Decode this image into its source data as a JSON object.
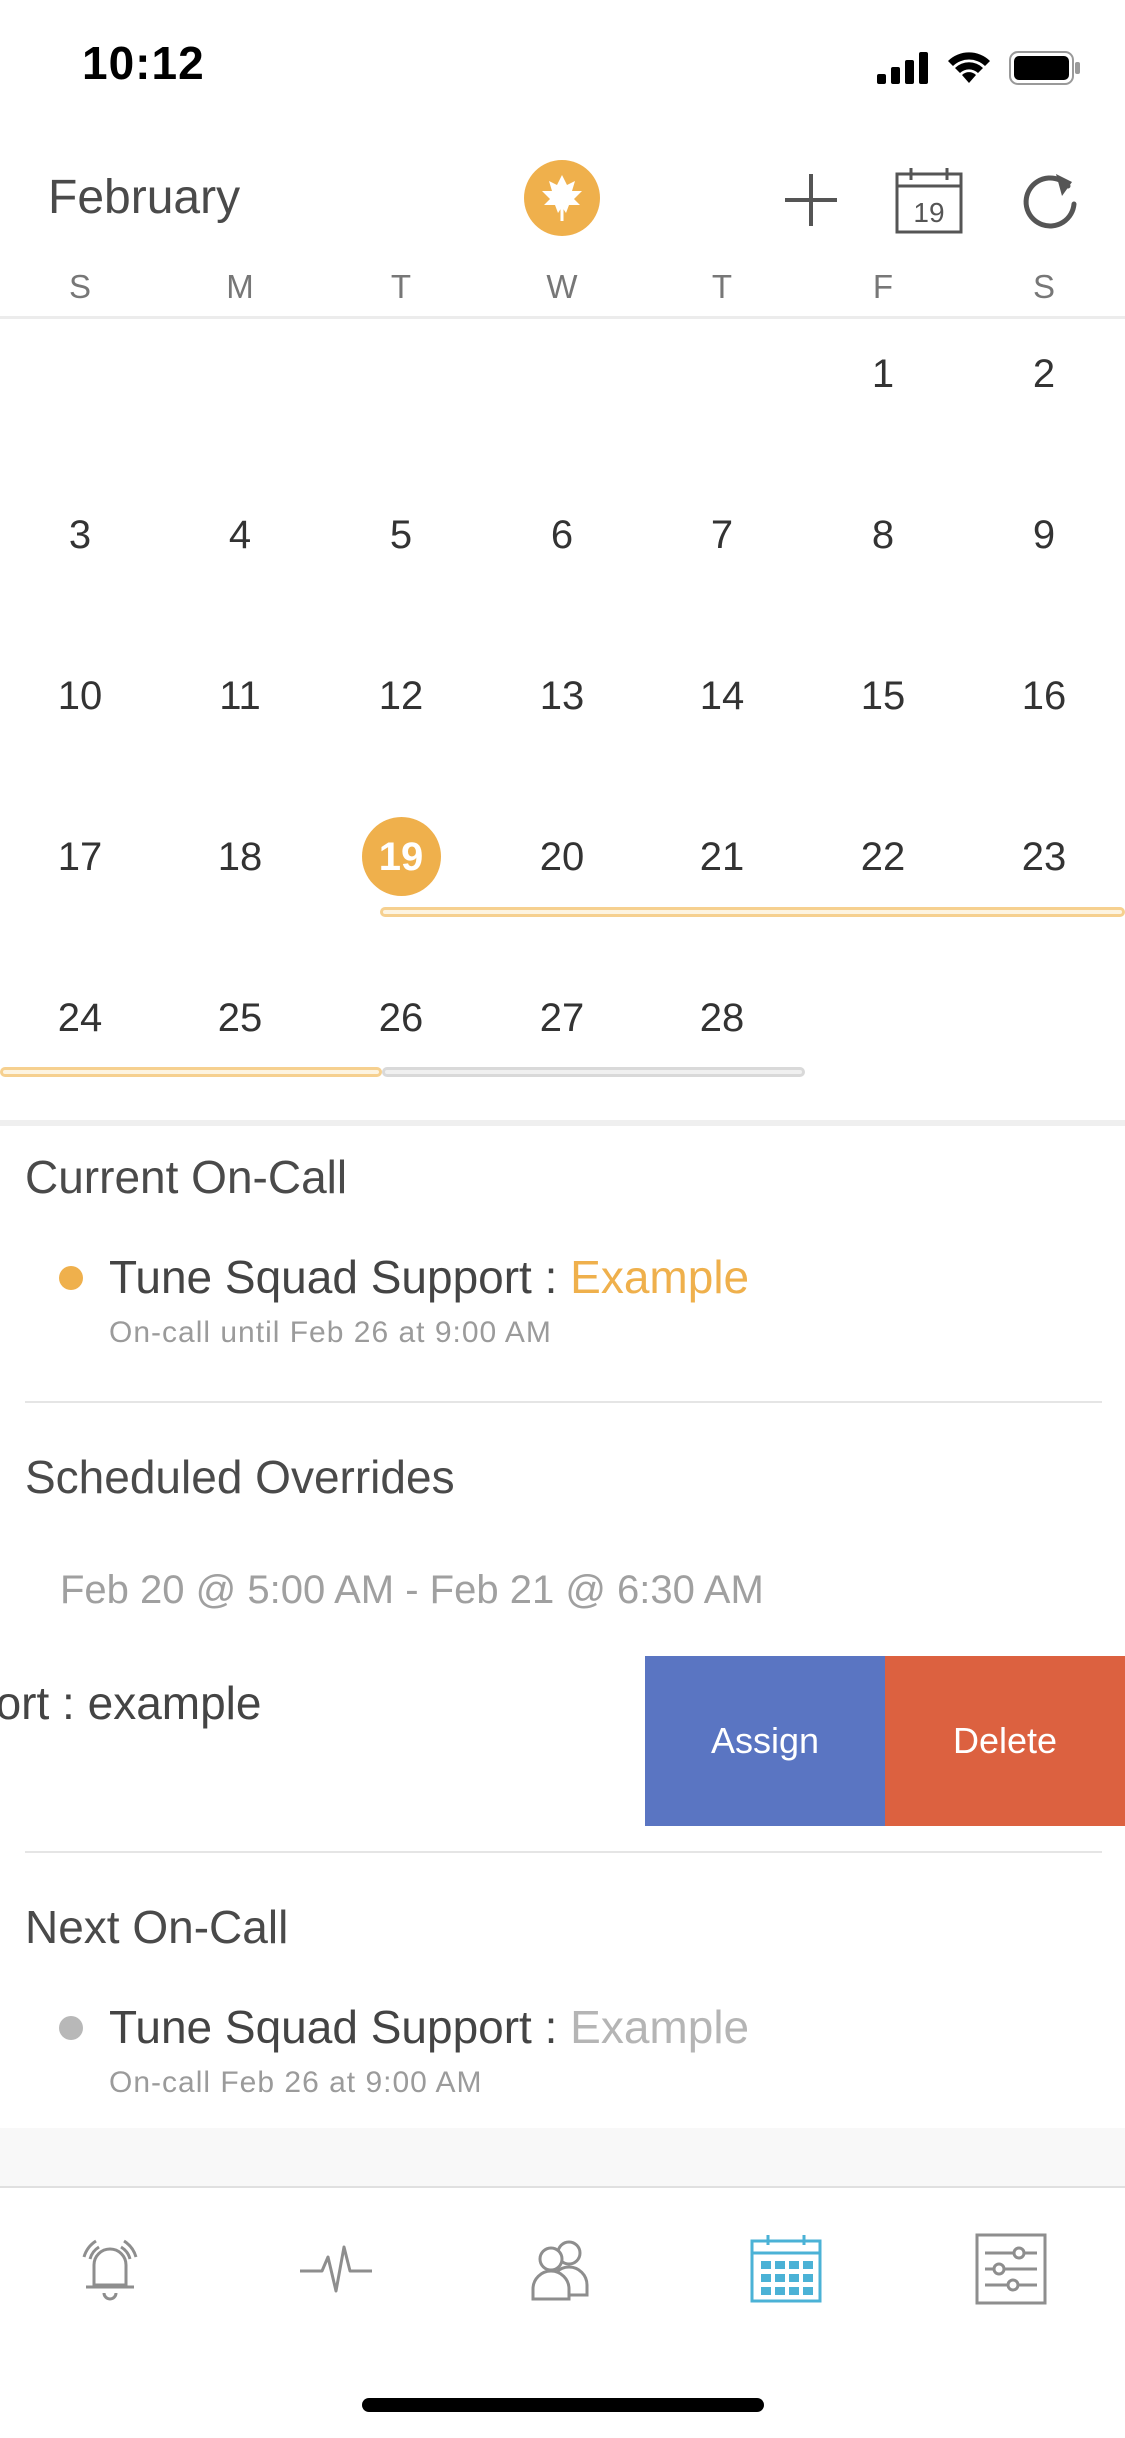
{
  "status_bar": {
    "time": "10:12"
  },
  "header": {
    "month": "February",
    "logo_icon": "leaf-icon",
    "add_icon": "plus-icon",
    "today_icon": "calendar-today-icon",
    "today_number": "19",
    "refresh_icon": "refresh-icon",
    "accent_color": "#efb04c"
  },
  "weekdays": [
    "S",
    "M",
    "T",
    "W",
    "T",
    "F",
    "S"
  ],
  "calendar": {
    "week1": [
      "",
      "",
      "",
      "",
      "",
      "1",
      "2"
    ],
    "week2": [
      "3",
      "4",
      "5",
      "6",
      "7",
      "8",
      "9"
    ],
    "week3": [
      "10",
      "11",
      "12",
      "13",
      "14",
      "15",
      "16"
    ],
    "week4": [
      "17",
      "18",
      "19",
      "20",
      "21",
      "22",
      "23"
    ],
    "week5": [
      "24",
      "25",
      "26",
      "27",
      "28",
      "",
      ""
    ],
    "selected_day": "19"
  },
  "current_oncall": {
    "title": "Current On-Call",
    "schedule": "Tune Squad Support : ",
    "user": "Example",
    "detail": "On-call until Feb 26 at 9:00 AM"
  },
  "overrides": {
    "title": "Scheduled Overrides",
    "time_range": "Feb 20 @ 5:00 AM - Feb 21 @ 6:30 AM",
    "name_partial": "port : example",
    "assign_label": "Assign",
    "delete_label": "Delete",
    "assign_color": "#5a75c2",
    "delete_color": "#dc6140"
  },
  "next_oncall": {
    "title": "Next On-Call",
    "schedule": "Tune Squad Support : ",
    "user": "Example",
    "detail": "On-call Feb 26 at 9:00 AM"
  },
  "tabbar": {
    "items": [
      {
        "name": "alerts",
        "icon": "bell-icon",
        "active": false
      },
      {
        "name": "activity",
        "icon": "pulse-icon",
        "active": false
      },
      {
        "name": "people",
        "icon": "users-icon",
        "active": false
      },
      {
        "name": "calendar",
        "icon": "calendar-grid-icon",
        "active": true
      },
      {
        "name": "settings",
        "icon": "sliders-icon",
        "active": false
      }
    ],
    "active_color": "#4bb2d6",
    "inactive_color": "#8e8e8e"
  }
}
